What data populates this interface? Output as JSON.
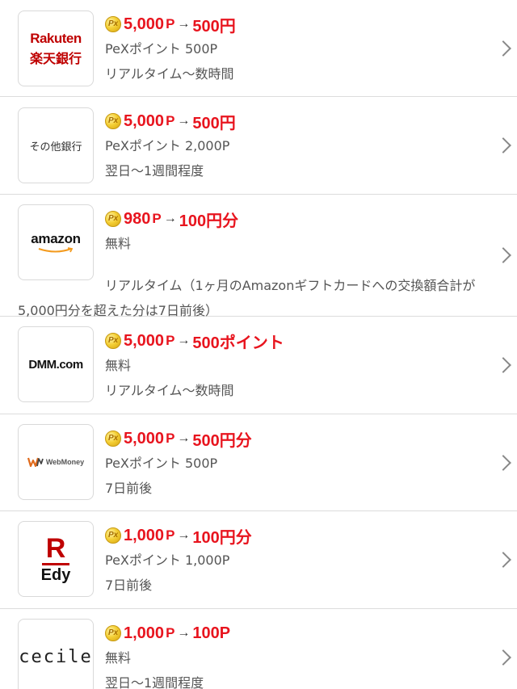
{
  "items": [
    {
      "logo_line1": "Rakuten",
      "logo_line2": "楽天銀行",
      "points": "5,000",
      "p": "P",
      "arrow": "→",
      "reward": "500円",
      "fee": "PeXポイント 500P",
      "timing": "リアルタイム～数時間"
    },
    {
      "logo_text": "その他銀行",
      "points": "5,000",
      "p": "P",
      "arrow": "→",
      "reward": "500円",
      "fee": "PeXポイント 2,000P",
      "timing": "翌日～1週間程度"
    },
    {
      "logo_text": "amazon",
      "points": "980",
      "p": "P",
      "arrow": "→",
      "reward": "100円分",
      "fee": "無料",
      "timing_line1": "リアルタイム（1ヶ月のAmazonギフトカードへの交換額合計が",
      "timing_line2": "5,000円分を超えた分は7日前後）"
    },
    {
      "logo_text": "DMM.com",
      "points": "5,000",
      "p": "P",
      "arrow": "→",
      "reward": "500ポイント",
      "fee": "無料",
      "timing": "リアルタイム～数時間"
    },
    {
      "logo_text": "WebMoney",
      "points": "5,000",
      "p": "P",
      "arrow": "→",
      "reward": "500円分",
      "fee": "PeXポイント 500P",
      "timing": "7日前後"
    },
    {
      "logo_line1": "R",
      "logo_line2": "Edy",
      "points": "1,000",
      "p": "P",
      "arrow": "→",
      "reward": "100円分",
      "fee": "PeXポイント 1,000P",
      "timing": "7日前後"
    },
    {
      "logo_text": "cecile",
      "points": "1,000",
      "p": "P",
      "arrow": "→",
      "reward": "100P",
      "fee": "無料",
      "timing": "翌日～1週間程度"
    }
  ],
  "colors": {
    "accent": "#e8141e",
    "text": "#555555",
    "divider": "#dcdcdc"
  },
  "icons": {
    "coin": "pex-coin-icon",
    "chevron": "chevron-right-icon"
  }
}
